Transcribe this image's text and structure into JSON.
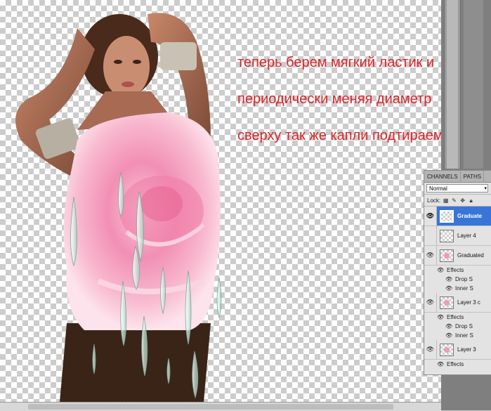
{
  "caption": {
    "line1": "теперь берем мягкий ластик и",
    "line2": "периодически меняя диаметр",
    "line3": "сверху так же капли подтираем."
  },
  "layers_panel": {
    "tabs": [
      "CHANNELS",
      "PATHS"
    ],
    "blend_mode": "Normal",
    "lock_label": "Lock:",
    "layers": [
      {
        "name": "Graduate",
        "selected": true,
        "visible": true
      },
      {
        "name": "Layer 4",
        "selected": false,
        "visible": false
      },
      {
        "name": "Graduated",
        "selected": false,
        "visible": true,
        "effects_label": "Effects",
        "effects": [
          "Drop S",
          "Inner S"
        ]
      },
      {
        "name": "Layer 3 c",
        "selected": false,
        "visible": true,
        "effects_label": "Effects",
        "effects": [
          "Drop S",
          "Inner S"
        ]
      },
      {
        "name": "Layer 3",
        "selected": false,
        "visible": true,
        "effects_label": "Effects",
        "effects": []
      }
    ]
  },
  "colors": {
    "caption_text": "#d8262b",
    "selected_layer": "#3875d7",
    "rose_pink": "#f4a0c0"
  },
  "icons": {
    "eye": "eye-icon",
    "lock_transparency": "checkerboard-lock-icon",
    "lock_paint": "brush-icon",
    "lock_move": "move-icon",
    "lock_all": "padlock-icon"
  }
}
